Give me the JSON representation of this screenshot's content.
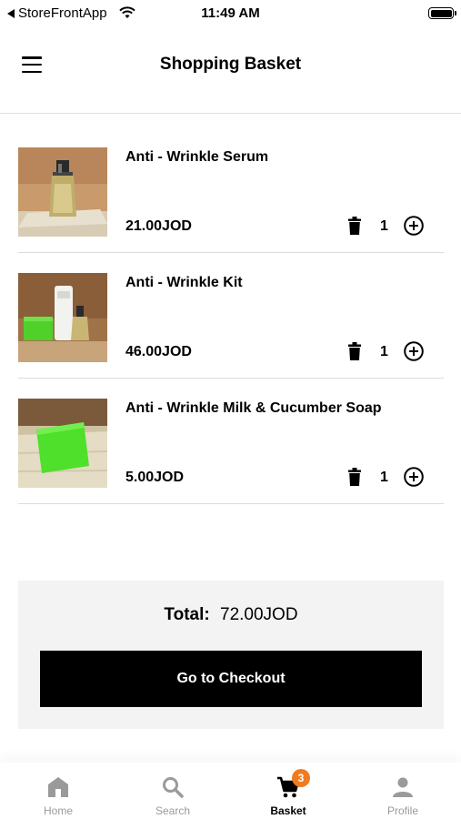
{
  "status_bar": {
    "back_app": "StoreFrontApp",
    "time": "11:49 AM"
  },
  "header": {
    "title": "Shopping Basket",
    "menu_icon": "hamburger-menu-icon"
  },
  "items": [
    {
      "name": "Anti - Wrinkle Serum",
      "price": "21.00JOD",
      "quantity": "1",
      "image": "serum-bottle-photo"
    },
    {
      "name": "Anti - Wrinkle Kit",
      "price": "46.00JOD",
      "quantity": "1",
      "image": "wrinkle-kit-photo"
    },
    {
      "name": "Anti - Wrinkle Milk & Cucumber Soap",
      "price": "5.00JOD",
      "quantity": "1",
      "image": "green-soap-photo"
    }
  ],
  "summary": {
    "total_label": "Total:",
    "total_value": "72.00JOD",
    "checkout_label": "Go to Checkout"
  },
  "bottom_nav": {
    "items": [
      {
        "label": "Home",
        "icon": "home-icon",
        "active": false
      },
      {
        "label": "Search",
        "icon": "search-icon",
        "active": false
      },
      {
        "label": "Basket",
        "icon": "cart-icon",
        "active": true,
        "badge": "3"
      },
      {
        "label": "Profile",
        "icon": "person-icon",
        "active": false
      }
    ]
  },
  "colors": {
    "accent_badge": "#f07b1f",
    "button_bg": "#000000",
    "summary_bg": "#f3f3f3",
    "inactive_nav": "#9a9a9a"
  }
}
